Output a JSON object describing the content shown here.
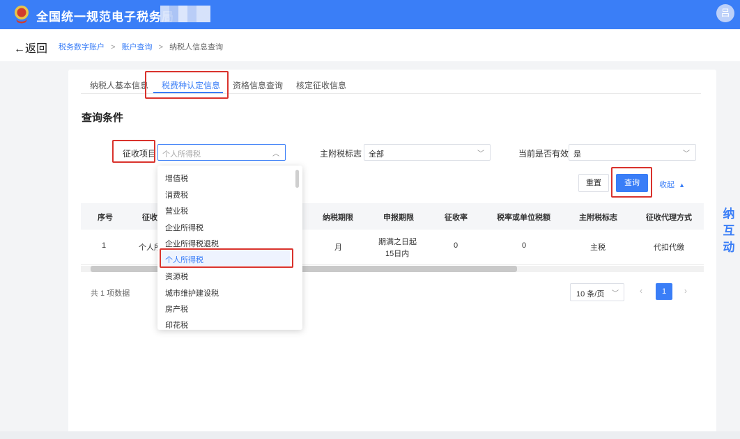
{
  "header": {
    "site_title": "全国统一规范电子税务局",
    "avatar_glyph": "吕"
  },
  "subbar": {
    "back_label": "←返回",
    "breadcrumb": [
      "税务数字账户",
      "账户查询",
      "纳税人信息查询"
    ],
    "breadcrumb_sep": ">"
  },
  "tabs": [
    {
      "label": "纳税人基本信息"
    },
    {
      "label": "税费种认定信息"
    },
    {
      "label": "资格信息查询"
    },
    {
      "label": "核定征收信息"
    }
  ],
  "query": {
    "section_title": "查询条件",
    "levy_item_label": "征收项目",
    "levy_item_placeholder": "个人所得税",
    "main_sub_label": "主附税标志",
    "main_sub_value": "全部",
    "valid_label": "当前是否有效",
    "valid_value": "是",
    "reset_label": "重置",
    "query_label": "查询",
    "collapse_label": "收起"
  },
  "dropdown": {
    "options": [
      "增值税",
      "消费税",
      "营业税",
      "企业所得税",
      "企业所得税退税",
      "个人所得税",
      "资源税",
      "城市维护建设税",
      "房产税",
      "印花税"
    ],
    "selected": "个人所得税"
  },
  "table": {
    "headers": [
      "序号",
      "征收",
      "纳税期限",
      "申报期限",
      "征收率",
      "税率或单位税额",
      "主附税标志",
      "征收代理方式"
    ],
    "row": {
      "index": "1",
      "levy_item_partial": "个人所",
      "period": "月",
      "deadline_line1": "期满之日起",
      "deadline_line2": "15日内",
      "rate": "0",
      "unit_tax": "0",
      "main_sub": "主税",
      "agent_mode": "代扣代缴"
    }
  },
  "pagination": {
    "total_text": "共 1 项数据",
    "page_size": "10 条/页",
    "current_page": "1",
    "prev_glyph": "‹",
    "next_glyph": "›"
  },
  "side_strip": {
    "lines": [
      "纳",
      "互",
      "动"
    ]
  },
  "colors": {
    "brand_blue": "#3a7ef7",
    "highlight_red": "#d9322c"
  }
}
